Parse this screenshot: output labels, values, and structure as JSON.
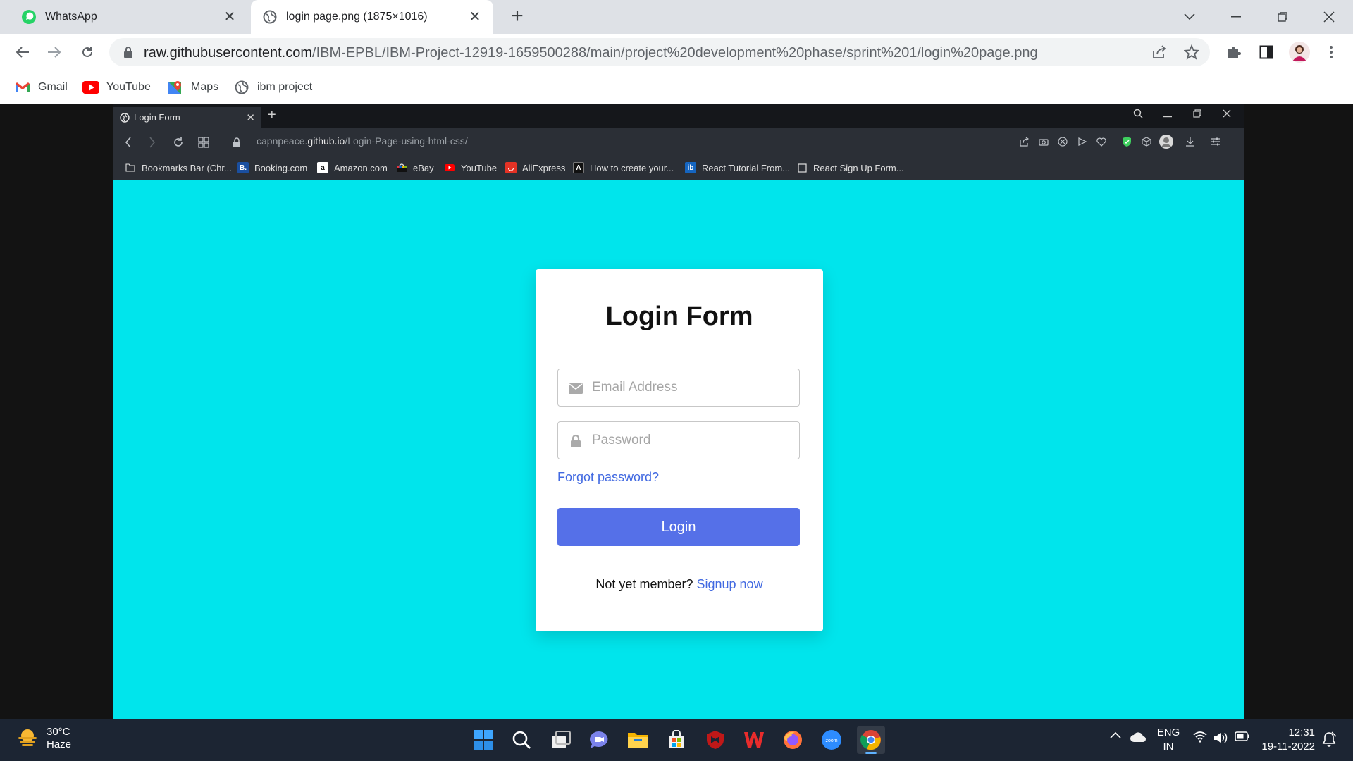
{
  "outer_browser": {
    "tabs": [
      {
        "label": "WhatsApp",
        "active": false
      },
      {
        "label": "login page.png (1875×1016)",
        "active": true
      }
    ],
    "address": {
      "host": "raw.githubusercontent.com",
      "path": "/IBM-EPBL/IBM-Project-12919-1659500288/main/project%20development%20phase/sprint%201/login%20page.png"
    },
    "bookmarks": [
      "Gmail",
      "YouTube",
      "Maps",
      "ibm project"
    ]
  },
  "inner_browser": {
    "tab_title": "Login Form",
    "url": {
      "prefix": "capnpeace.",
      "host": "github.io",
      "path": "/Login-Page-using-html-css/"
    },
    "bookmarks": [
      "Bookmarks Bar (Chr...",
      "Booking.com",
      "Amazon.com",
      "eBay",
      "YouTube",
      "AliExpress",
      "How to create your...",
      "React Tutorial From...",
      "React Sign Up Form..."
    ]
  },
  "login_form": {
    "title": "Login Form",
    "email_placeholder": "Email Address",
    "password_placeholder": "Password",
    "forgot_link": "Forgot password?",
    "login_button": "Login",
    "signup_prompt": "Not yet member?",
    "signup_link": "Signup now",
    "accent_color": "#5570e8",
    "background_color": "#00e5ec"
  },
  "taskbar": {
    "weather": {
      "temp": "30°C",
      "condition": "Haze"
    },
    "language": {
      "line1": "ENG",
      "line2": "IN"
    },
    "clock": {
      "time": "12:31",
      "date": "19-11-2022"
    },
    "apps": [
      "start-icon",
      "search-icon",
      "task-view-icon",
      "chat-icon",
      "file-explorer-icon",
      "store-icon",
      "mcafee-icon",
      "wps-icon",
      "firefox-icon",
      "zoom-icon",
      "chrome-icon"
    ]
  }
}
